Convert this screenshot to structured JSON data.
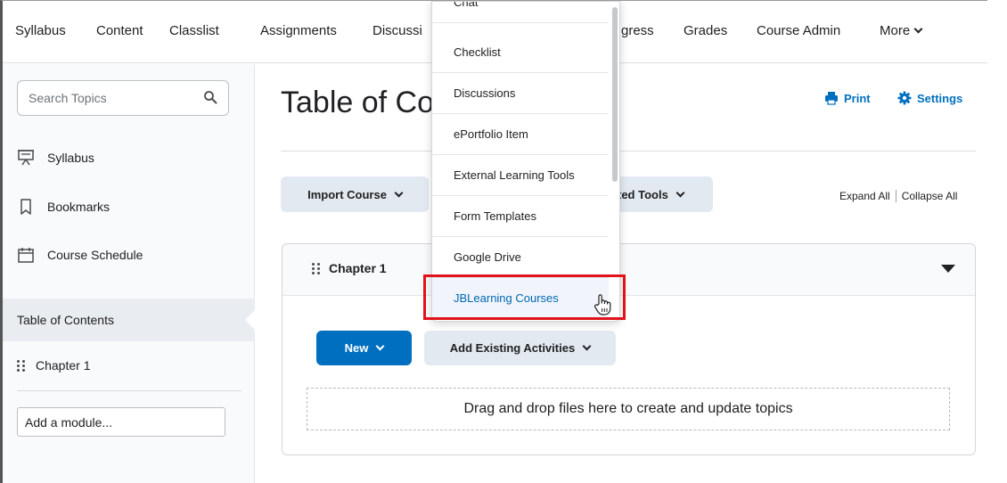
{
  "nav": {
    "items": [
      "Syllabus",
      "Content",
      "Classlist",
      "Assignments",
      "Discussi",
      "gress",
      "Grades",
      "Course Admin"
    ],
    "more": "More"
  },
  "sidebar": {
    "search_placeholder": "Search Topics",
    "links": [
      "Syllabus",
      "Bookmarks",
      "Course Schedule"
    ],
    "toc": "Table of Contents",
    "chapter": "Chapter 1",
    "add_module": "Add a module..."
  },
  "main": {
    "title": "Table of Co",
    "print": "Print",
    "settings": "Settings",
    "import_course": "Import Course",
    "related_tools": "ted Tools",
    "expand_all": "Expand All",
    "collapse_all": "Collapse All",
    "module_title": "Chapter 1",
    "new_button": "New",
    "add_existing": "Add Existing Activities",
    "dropzone": "Drag and drop files here to create and update topics"
  },
  "dropdown": {
    "items": [
      "Chat",
      "Checklist",
      "Discussions",
      "ePortfolio Item",
      "External Learning Tools",
      "Form Templates",
      "Google Drive",
      "JBLearning Courses"
    ],
    "highlighted": "JBLearning Courses"
  },
  "colors": {
    "accent": "#006fbf",
    "highlight": "#e1131a"
  }
}
